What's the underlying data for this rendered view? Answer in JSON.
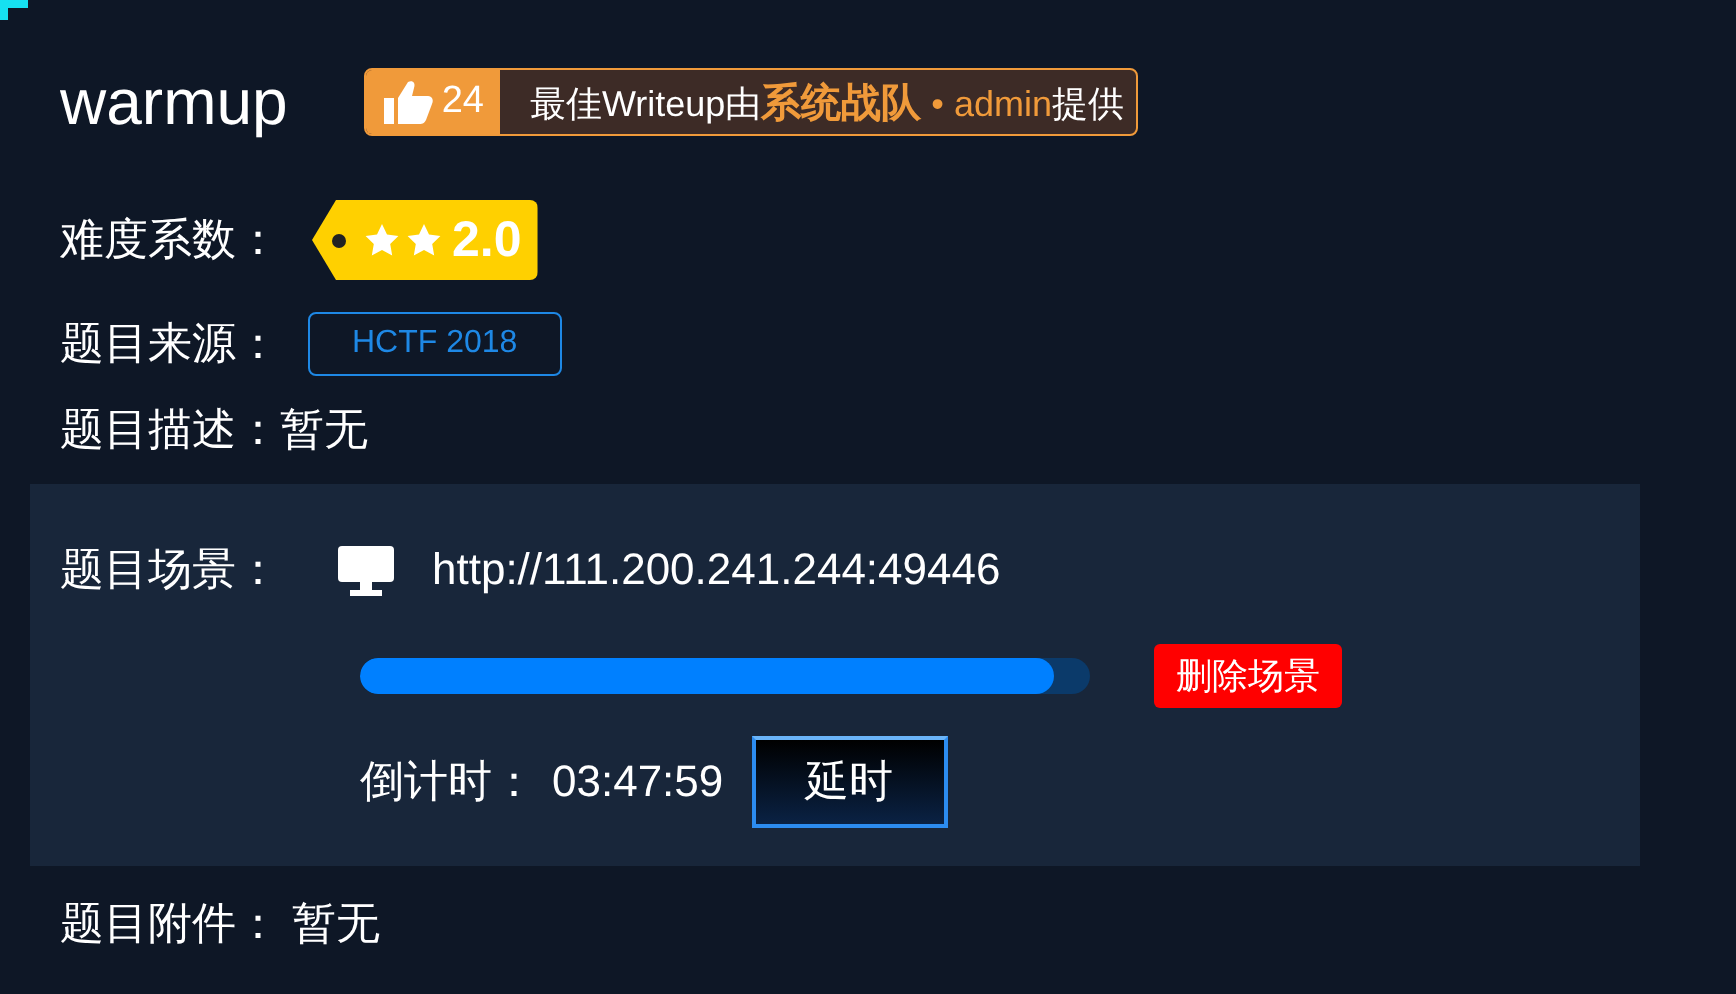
{
  "challenge": {
    "title": "warmup",
    "likes": "24",
    "writeup": {
      "prefix": "最佳Writeup由",
      "team": "系统战队",
      "separator": "•",
      "author": "admin",
      "suffix": "提供"
    }
  },
  "difficulty": {
    "label": "难度系数：",
    "score": "2.0"
  },
  "source": {
    "label": "题目来源：",
    "tag": "HCTF 2018"
  },
  "description": {
    "label": "题目描述：",
    "value": "暂无"
  },
  "scene": {
    "label": "题目场景：",
    "url": "http://111.200.241.244:49446",
    "level": 0.95,
    "delete_button": "删除场景",
    "countdown_label": "倒计时：",
    "countdown": "03:47:59",
    "extend_button": "延时"
  },
  "attachment": {
    "label": "题目附件：",
    "value": "暂无"
  }
}
